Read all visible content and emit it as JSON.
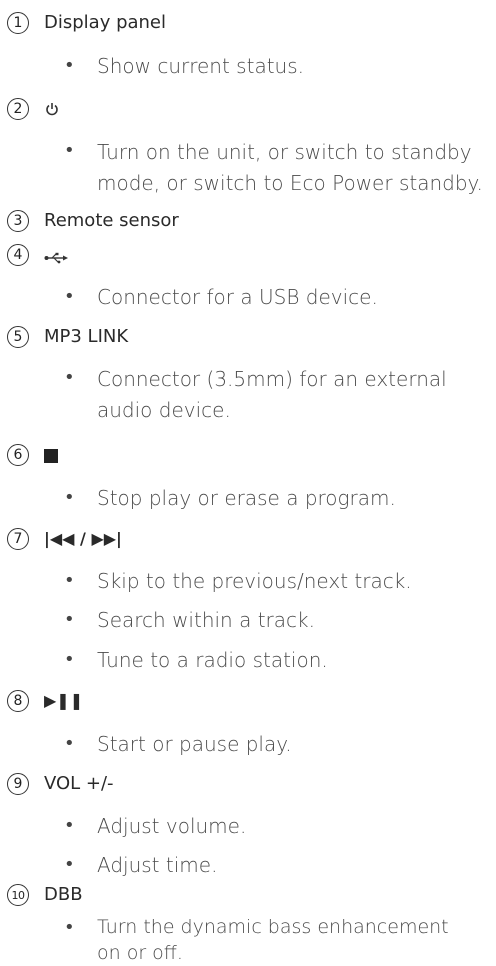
{
  "items": [
    {
      "num": "1",
      "title": "Display panel",
      "bullets": [
        "Show current status."
      ]
    },
    {
      "num": "2",
      "icon": "power-icon",
      "bullets": [
        "Turn on the unit, or switch to standby mode, or switch to Eco Power standby."
      ]
    },
    {
      "num": "3",
      "title": "Remote sensor",
      "bullets": []
    },
    {
      "num": "4",
      "icon": "usb-icon",
      "bullets": [
        "Connector for a USB device."
      ]
    },
    {
      "num": "5",
      "title": "MP3 LINK",
      "bullets": [
        "Connector (3.5mm) for an external audio device."
      ]
    },
    {
      "num": "6",
      "icon": "stop-icon",
      "bullets": [
        "Stop play or erase a program."
      ]
    },
    {
      "num": "7",
      "title": "|◀◀ / ▶▶|",
      "bullets": [
        "Skip to the previous/next track.",
        "Search within a track.",
        "Tune to a radio station."
      ]
    },
    {
      "num": "8",
      "title": "▶❚❚",
      "bullets": [
        "Start or pause play."
      ]
    },
    {
      "num": "9",
      "title": "VOL +/-",
      "bullets": [
        "Adjust volume.",
        "Adjust time."
      ]
    },
    {
      "num": "10",
      "title": "DBB",
      "bullets": [
        "Turn the dynamic bass enhancement on or off."
      ]
    }
  ],
  "bullet_char": "•"
}
